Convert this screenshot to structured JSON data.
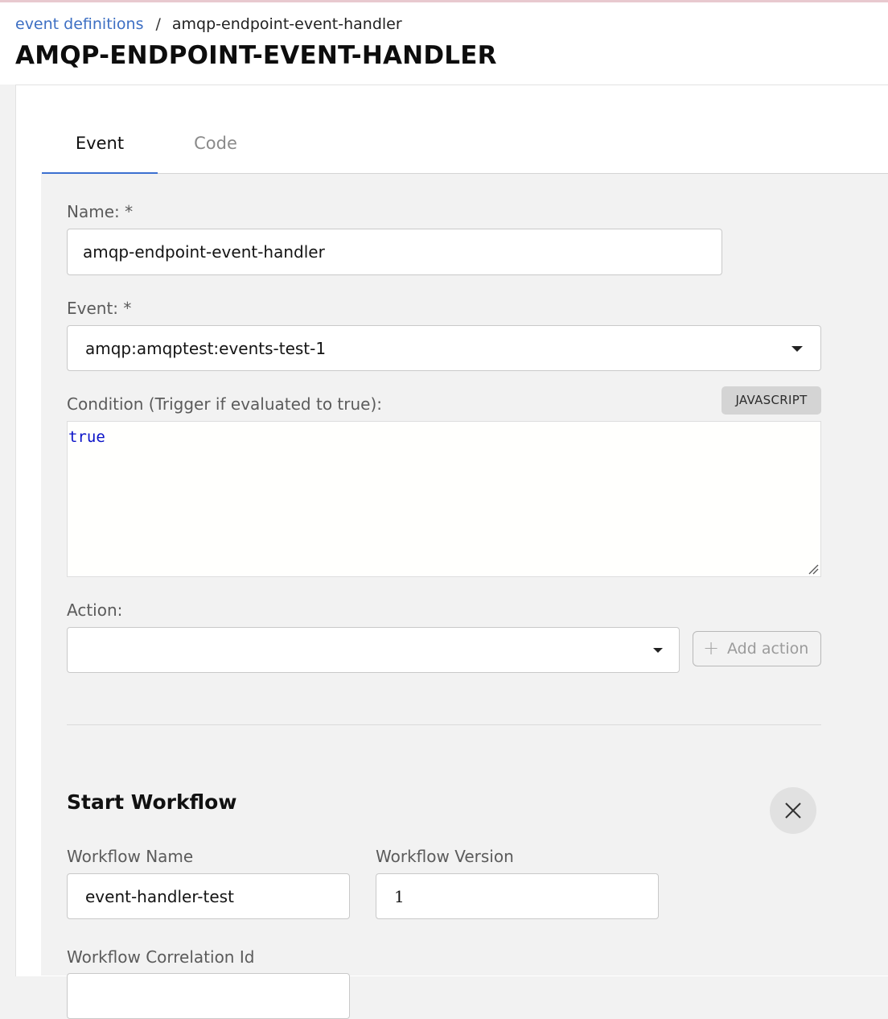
{
  "breadcrumb": {
    "link": "event definitions",
    "separator": "/",
    "current": "amqp-endpoint-event-handler"
  },
  "page_title": "AMQP-ENDPOINT-EVENT-HANDLER",
  "tabs": [
    {
      "label": "Event",
      "active": true
    },
    {
      "label": "Code",
      "active": false
    }
  ],
  "form": {
    "name": {
      "label": "Name: *",
      "value": "amqp-endpoint-event-handler"
    },
    "event": {
      "label": "Event: *",
      "value": "amqp:amqptest:events-test-1"
    },
    "condition": {
      "label": "Condition (Trigger if evaluated to true):",
      "language_badge": "JAVASCRIPT",
      "value": "true"
    },
    "action": {
      "label": "Action:",
      "value": "",
      "add_button_label": "Add action"
    }
  },
  "start_workflow": {
    "title": "Start Workflow",
    "workflow_name": {
      "label": "Workflow Name",
      "value": "event-handler-test"
    },
    "workflow_version": {
      "label": "Workflow Version",
      "value": "1"
    },
    "workflow_correlation_id": {
      "label": "Workflow Correlation Id",
      "value": ""
    }
  },
  "colors": {
    "accent": "#3b6fd0",
    "link": "#3d6fc3",
    "code_keyword": "#0a12c8",
    "panel_background": "#f2f2f2"
  },
  "icons": {
    "dropdown": "chevron-down-icon",
    "add": "plus-icon",
    "close": "close-icon",
    "resize": "resize-grip-icon"
  }
}
